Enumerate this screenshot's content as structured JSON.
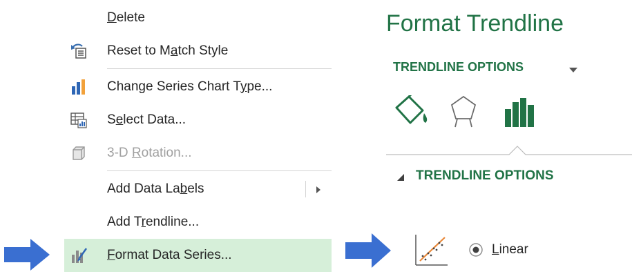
{
  "context_menu": {
    "items": [
      {
        "pre": "",
        "key": "D",
        "post": "elete",
        "disabled": false,
        "icon": "none"
      },
      {
        "pre": "Reset to M",
        "key": "a",
        "post": "tch Style",
        "disabled": false,
        "icon": "reset-style-icon"
      },
      {
        "pre": "Change Series Chart T",
        "key": "y",
        "post": "pe...",
        "disabled": false,
        "icon": "bar-chart-icon"
      },
      {
        "pre": "S",
        "key": "e",
        "post": "lect Data...",
        "disabled": false,
        "icon": "select-data-icon"
      },
      {
        "pre": "3-D ",
        "key": "R",
        "post": "otation...",
        "disabled": true,
        "icon": "3d-rotation-icon"
      },
      {
        "pre": "Add Data La",
        "key": "b",
        "post": "els",
        "disabled": false,
        "icon": "none"
      },
      {
        "pre": "Add T",
        "key": "r",
        "post": "endline...",
        "disabled": false,
        "icon": "none"
      },
      {
        "pre": "",
        "key": "F",
        "post": "ormat Data Series...",
        "disabled": false,
        "icon": "format-series-icon"
      }
    ]
  },
  "pane": {
    "title": "Format Trendline",
    "dropdown_label": "TRENDLINE OPTIONS",
    "tabs": [
      {
        "icon": "fill-line-icon"
      },
      {
        "icon": "effects-pentagon-icon"
      },
      {
        "icon": "trendline-options-bars-icon"
      }
    ],
    "section_label": "TRENDLINE OPTIONS",
    "option": {
      "key": "L",
      "rest": "inear",
      "selected": true,
      "icon": "linear-trendline-icon"
    }
  },
  "colors": {
    "accent": "#217346",
    "arrow": "#3a6fd1",
    "highlight": "#d6efd9"
  }
}
